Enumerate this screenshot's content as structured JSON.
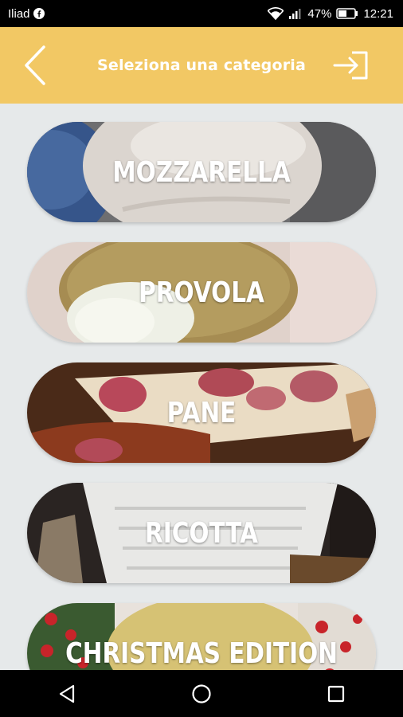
{
  "status_bar": {
    "carrier": "Iliad",
    "battery": "47%",
    "time": "12:21",
    "icons": [
      "facebook-icon",
      "wifi-icon",
      "signal-icon",
      "battery-icon"
    ]
  },
  "header": {
    "title": "Seleziona una categoria",
    "background": "#f2c864",
    "back_icon": "chevron-left-icon",
    "logout_icon": "logout-icon"
  },
  "categories": [
    {
      "label": "MOZZARELLA"
    },
    {
      "label": "PROVOLA"
    },
    {
      "label": "PANE"
    },
    {
      "label": "RICOTTA"
    },
    {
      "label": "CHRISTMAS EDITION"
    }
  ],
  "nav_bar": {
    "icons": [
      "back-triangle-icon",
      "home-circle-icon",
      "recents-square-icon"
    ]
  }
}
